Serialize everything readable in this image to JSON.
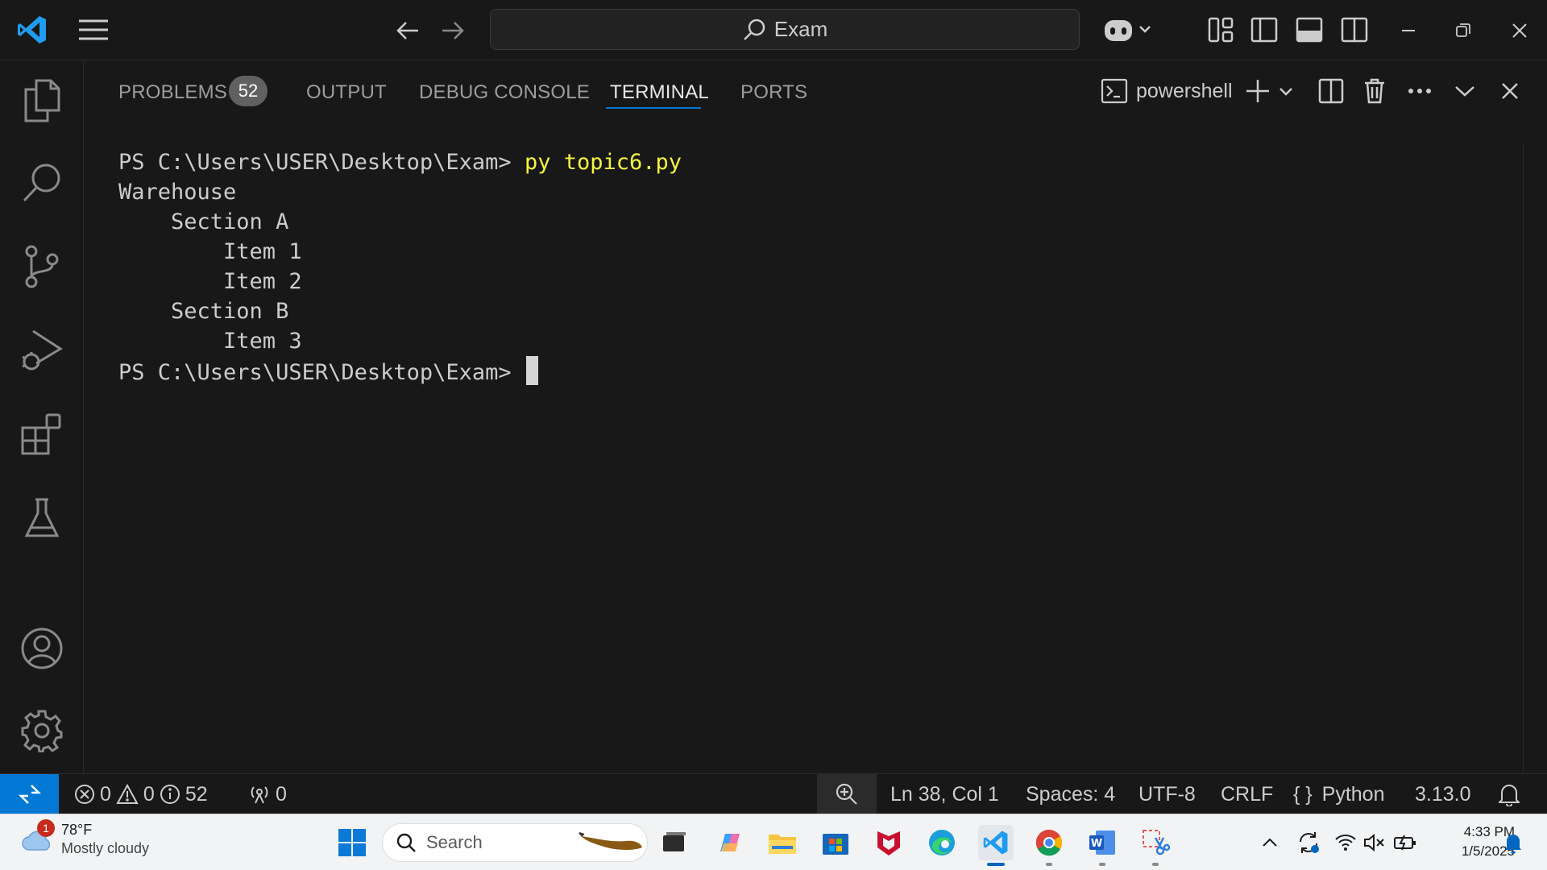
{
  "titlebar": {
    "search_text": "Exam",
    "icons": [
      "vscode-logo-icon",
      "menu-icon",
      "back-arrow-icon",
      "forward-arrow-icon",
      "copilot-icon",
      "customize-layout-icon",
      "toggle-sidebar-icon",
      "toggle-panel-icon",
      "toggle-secondary-sidebar-icon",
      "minimize-icon",
      "restore-icon",
      "close-icon"
    ]
  },
  "activitybar": {
    "items": [
      "explorer-icon",
      "search-icon",
      "source-control-icon",
      "run-debug-icon",
      "extensions-icon",
      "testing-icon"
    ],
    "bottom": [
      "accounts-icon",
      "manage-gear-icon"
    ]
  },
  "panel": {
    "tabs": [
      {
        "label": "PROBLEMS",
        "badge": "52"
      },
      {
        "label": "OUTPUT"
      },
      {
        "label": "DEBUG CONSOLE"
      },
      {
        "label": "TERMINAL",
        "active": true
      },
      {
        "label": "PORTS"
      }
    ],
    "shell_name": "powershell"
  },
  "terminal": {
    "prompt": "PS C:\\Users\\USER\\Desktop\\Exam>",
    "command": "py topic6.py",
    "output": [
      "Warehouse",
      "    Section A",
      "        Item 1",
      "        Item 2",
      "    Section B",
      "        Item 3"
    ]
  },
  "statusbar": {
    "errors": "0",
    "warnings": "0",
    "infos": "52",
    "ports": "0",
    "position": "Ln 38, Col 1",
    "spaces": "Spaces: 4",
    "encoding": "UTF-8",
    "eol": "CRLF",
    "language": "Python",
    "python_version": "3.13.0"
  },
  "taskbar": {
    "weather_temp": "78°F",
    "weather_desc": "Mostly cloudy",
    "weather_badge": "1",
    "search_placeholder": "Search",
    "time": "4:33 PM",
    "date": "1/5/2025"
  },
  "colors": {
    "background": "#181818",
    "accent": "#0078d4",
    "command_yellow": "#f5f543",
    "taskbar": "#f1f3f5"
  }
}
